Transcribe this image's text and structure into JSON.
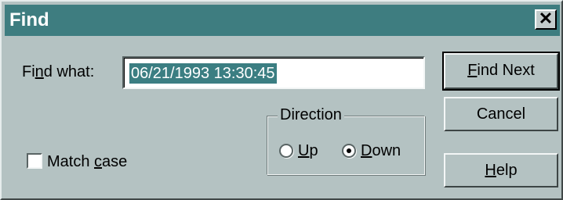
{
  "window": {
    "title": "Find",
    "close_glyph": "✕",
    "titlebar_color": "#3e7d80",
    "face_color": "#b4c2c2"
  },
  "find_what": {
    "label_pre": "Fi",
    "label_accel": "n",
    "label_post": "d what:",
    "value": "06/21/1993 13:30:45"
  },
  "direction": {
    "legend": "Direction",
    "up": {
      "accel": "U",
      "rest": "p",
      "selected": false
    },
    "down": {
      "accel": "D",
      "rest": "own",
      "selected": true
    }
  },
  "match_case": {
    "pre": "Match ",
    "accel": "c",
    "post": "ase",
    "checked": false
  },
  "buttons": {
    "find_next": {
      "accel": "F",
      "rest": "ind Next"
    },
    "cancel": {
      "label": "Cancel"
    },
    "help": {
      "accel": "H",
      "rest": "elp"
    }
  }
}
